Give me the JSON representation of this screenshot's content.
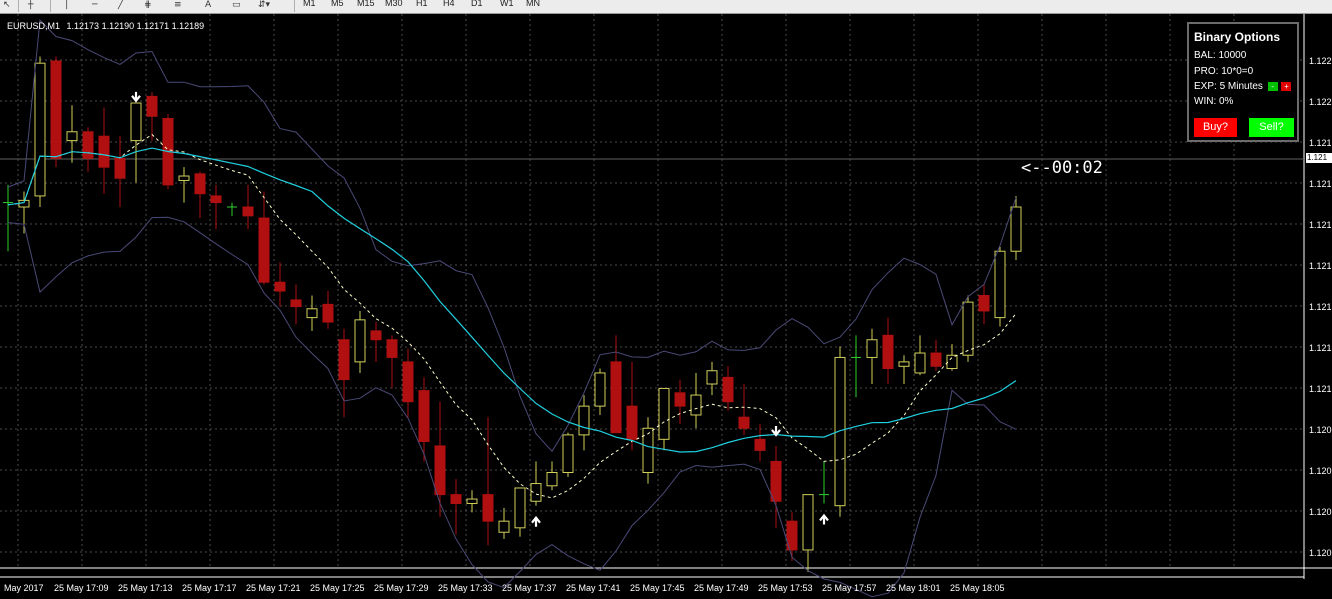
{
  "toolbar": {
    "timeframes": [
      "M1",
      "M5",
      "M15",
      "M30",
      "H1",
      "H4",
      "D1",
      "W1",
      "MN"
    ]
  },
  "symbol": {
    "name": "EURUSD,M1",
    "ohlc": "1.12173 1.12190 1.12171 1.12189"
  },
  "panel": {
    "title": "Binary Options",
    "balance": "BAL: 10000",
    "profit": "PRO: 10*0=0",
    "expiry": "EXP: 5 Minutes",
    "win": "WIN: 0%",
    "minus_label": "-",
    "plus_label": "+",
    "buy_label": "Buy?",
    "sell_label": "Sell?"
  },
  "timer": "<--00:02",
  "colors": {
    "background": "#000000",
    "grid": "#4a4a4a",
    "bull": "#d0d05a",
    "bear": "#b01010",
    "doji": "#30d030",
    "band": "#4a4a78",
    "mid_line": "#ffffcc",
    "cyan_line": "#20d0e0",
    "buy_button": "#ff0000",
    "sell_button": "#00ff00"
  },
  "chart_data": {
    "type": "candlestick",
    "symbol": "EURUSD",
    "timeframe": "M1",
    "current_price_label": "1.121",
    "y_tick_labels": [
      "1.122",
      "1.122",
      "1.121",
      "1.121",
      "1.121",
      "1.121",
      "1.121",
      "1.121",
      "1.121",
      "1.120",
      "1.120",
      "1.120",
      "1.120"
    ],
    "x_tick_labels": [
      "May 2017",
      "25 May 17:09",
      "25 May 17:13",
      "25 May 17:17",
      "25 May 17:21",
      "25 May 17:25",
      "25 May 17:29",
      "25 May 17:33",
      "25 May 17:37",
      "25 May 17:41",
      "25 May 17:45",
      "25 May 17:49",
      "25 May 17:53",
      "25 May 17:57",
      "25 May 18:01",
      "25 May 18:05"
    ],
    "ylim": [
      1.1201,
      1.1225
    ],
    "candles": [
      {
        "o": 1.12172,
        "h": 1.1218,
        "l": 1.1215,
        "c": 1.12171
      },
      {
        "o": 1.1217,
        "h": 1.12177,
        "l": 1.12158,
        "c": 1.12173
      },
      {
        "o": 1.12175,
        "h": 1.12238,
        "l": 1.1217,
        "c": 1.12235
      },
      {
        "o": 1.12236,
        "h": 1.12238,
        "l": 1.12188,
        "c": 1.12192
      },
      {
        "o": 1.122,
        "h": 1.12216,
        "l": 1.1219,
        "c": 1.12204
      },
      {
        "o": 1.12204,
        "h": 1.12206,
        "l": 1.12186,
        "c": 1.12192
      },
      {
        "o": 1.12202,
        "h": 1.12215,
        "l": 1.12176,
        "c": 1.12188
      },
      {
        "o": 1.12192,
        "h": 1.12202,
        "l": 1.1217,
        "c": 1.12183
      },
      {
        "o": 1.122,
        "h": 1.12213,
        "l": 1.12181,
        "c": 1.12217
      },
      {
        "o": 1.1222,
        "h": 1.12222,
        "l": 1.122,
        "c": 1.12211
      },
      {
        "o": 1.1221,
        "h": 1.12212,
        "l": 1.12178,
        "c": 1.1218
      },
      {
        "o": 1.12182,
        "h": 1.12188,
        "l": 1.12172,
        "c": 1.12184
      },
      {
        "o": 1.12185,
        "h": 1.12186,
        "l": 1.12165,
        "c": 1.12176
      },
      {
        "o": 1.12175,
        "h": 1.1218,
        "l": 1.1216,
        "c": 1.12172
      },
      {
        "o": 1.1217,
        "h": 1.12172,
        "l": 1.12166,
        "c": 1.12169
      },
      {
        "o": 1.1217,
        "h": 1.1218,
        "l": 1.1216,
        "c": 1.12166
      },
      {
        "o": 1.12165,
        "h": 1.12177,
        "l": 1.12135,
        "c": 1.12136
      },
      {
        "o": 1.12136,
        "h": 1.12145,
        "l": 1.12125,
        "c": 1.12132
      },
      {
        "o": 1.12128,
        "h": 1.12135,
        "l": 1.12117,
        "c": 1.12125
      },
      {
        "o": 1.1212,
        "h": 1.1213,
        "l": 1.12114,
        "c": 1.12124
      },
      {
        "o": 1.12126,
        "h": 1.12132,
        "l": 1.12115,
        "c": 1.12118
      },
      {
        "o": 1.1211,
        "h": 1.12115,
        "l": 1.12075,
        "c": 1.12092
      },
      {
        "o": 1.121,
        "h": 1.12123,
        "l": 1.12095,
        "c": 1.12119
      },
      {
        "o": 1.12114,
        "h": 1.12118,
        "l": 1.121,
        "c": 1.1211
      },
      {
        "o": 1.1211,
        "h": 1.12112,
        "l": 1.12088,
        "c": 1.12102
      },
      {
        "o": 1.121,
        "h": 1.12106,
        "l": 1.12075,
        "c": 1.12082
      },
      {
        "o": 1.12087,
        "h": 1.12093,
        "l": 1.12055,
        "c": 1.12064
      },
      {
        "o": 1.12062,
        "h": 1.12082,
        "l": 1.1203,
        "c": 1.1204
      },
      {
        "o": 1.1204,
        "h": 1.12047,
        "l": 1.12022,
        "c": 1.12036
      },
      {
        "o": 1.12036,
        "h": 1.12042,
        "l": 1.12032,
        "c": 1.12038
      },
      {
        "o": 1.1204,
        "h": 1.12075,
        "l": 1.12017,
        "c": 1.12028
      },
      {
        "o": 1.12023,
        "h": 1.12034,
        "l": 1.1202,
        "c": 1.12028
      },
      {
        "o": 1.12025,
        "h": 1.12043,
        "l": 1.12021,
        "c": 1.12043
      },
      {
        "o": 1.12037,
        "h": 1.12055,
        "l": 1.12035,
        "c": 1.12045
      },
      {
        "o": 1.12044,
        "h": 1.12055,
        "l": 1.12042,
        "c": 1.1205
      },
      {
        "o": 1.1205,
        "h": 1.12068,
        "l": 1.12048,
        "c": 1.12067
      },
      {
        "o": 1.12067,
        "h": 1.12085,
        "l": 1.1206,
        "c": 1.1208
      },
      {
        "o": 1.1208,
        "h": 1.12097,
        "l": 1.12076,
        "c": 1.12095
      },
      {
        "o": 1.121,
        "h": 1.12112,
        "l": 1.12085,
        "c": 1.12068
      },
      {
        "o": 1.1208,
        "h": 1.121,
        "l": 1.1206,
        "c": 1.12065
      },
      {
        "o": 1.1205,
        "h": 1.12075,
        "l": 1.12045,
        "c": 1.1207
      },
      {
        "o": 1.12065,
        "h": 1.12087,
        "l": 1.1206,
        "c": 1.12088
      },
      {
        "o": 1.12086,
        "h": 1.12092,
        "l": 1.12072,
        "c": 1.1208
      },
      {
        "o": 1.12076,
        "h": 1.12095,
        "l": 1.1207,
        "c": 1.12085
      },
      {
        "o": 1.1209,
        "h": 1.121,
        "l": 1.12085,
        "c": 1.12096
      },
      {
        "o": 1.12093,
        "h": 1.12098,
        "l": 1.12078,
        "c": 1.12082
      },
      {
        "o": 1.12075,
        "h": 1.1209,
        "l": 1.12067,
        "c": 1.1207
      },
      {
        "o": 1.12065,
        "h": 1.12072,
        "l": 1.12055,
        "c": 1.1206
      },
      {
        "o": 1.12055,
        "h": 1.12062,
        "l": 1.12025,
        "c": 1.12037
      },
      {
        "o": 1.12028,
        "h": 1.12032,
        "l": 1.1201,
        "c": 1.12015
      },
      {
        "o": 1.12015,
        "h": 1.1204,
        "l": 1.12005,
        "c": 1.1204
      },
      {
        "o": 1.1204,
        "h": 1.12055,
        "l": 1.12036,
        "c": 1.1204
      },
      {
        "o": 1.12035,
        "h": 1.12107,
        "l": 1.1203,
        "c": 1.12102
      },
      {
        "o": 1.12102,
        "h": 1.12112,
        "l": 1.12084,
        "c": 1.12102
      },
      {
        "o": 1.12102,
        "h": 1.12115,
        "l": 1.1209,
        "c": 1.1211
      },
      {
        "o": 1.12112,
        "h": 1.1212,
        "l": 1.1209,
        "c": 1.12097
      },
      {
        "o": 1.12098,
        "h": 1.12103,
        "l": 1.1209,
        "c": 1.121
      },
      {
        "o": 1.12095,
        "h": 1.12112,
        "l": 1.12094,
        "c": 1.12104
      },
      {
        "o": 1.12104,
        "h": 1.1211,
        "l": 1.12096,
        "c": 1.12098
      },
      {
        "o": 1.12097,
        "h": 1.12108,
        "l": 1.12096,
        "c": 1.12103
      },
      {
        "o": 1.12103,
        "h": 1.1213,
        "l": 1.121,
        "c": 1.12127
      },
      {
        "o": 1.1213,
        "h": 1.12135,
        "l": 1.12117,
        "c": 1.12123
      },
      {
        "o": 1.1212,
        "h": 1.12152,
        "l": 1.12116,
        "c": 1.1215
      },
      {
        "o": 1.1215,
        "h": 1.12175,
        "l": 1.12146,
        "c": 1.1217
      }
    ],
    "signals": [
      {
        "direction": "down",
        "candle": 8
      },
      {
        "direction": "up",
        "candle": 33
      },
      {
        "direction": "down",
        "candle": 48
      },
      {
        "direction": "up",
        "candle": 51
      }
    ]
  }
}
